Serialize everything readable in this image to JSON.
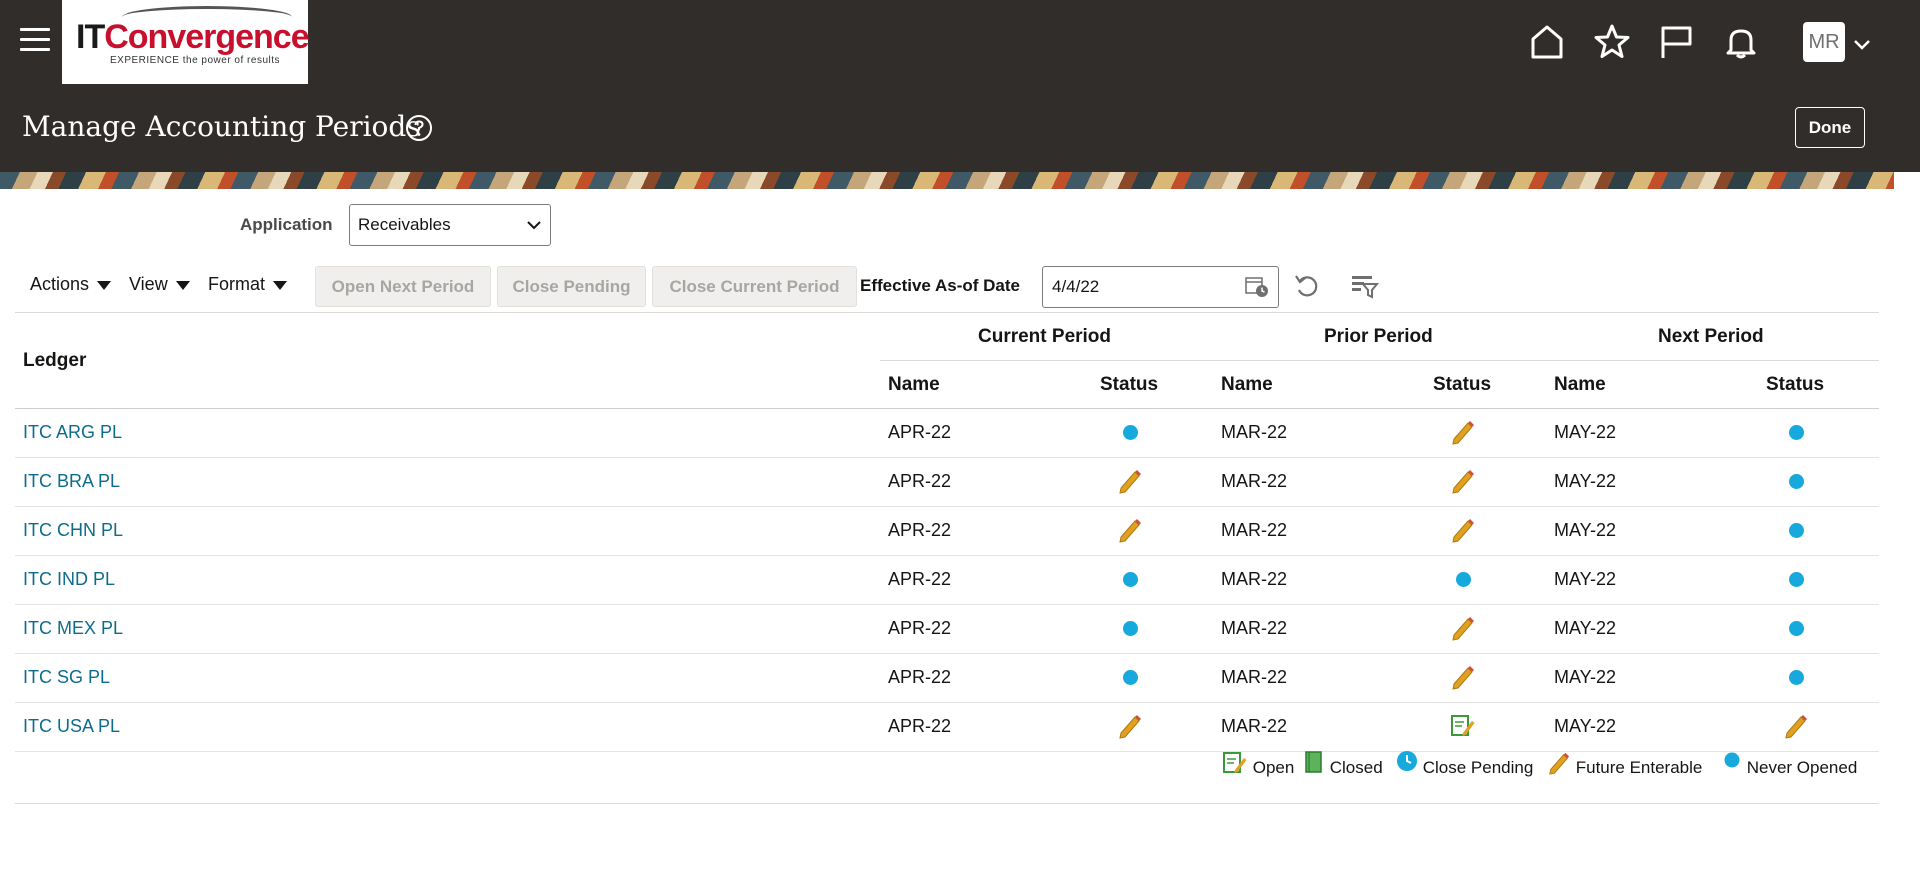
{
  "header": {
    "logo_it": "IT",
    "logo_conv": "Convergence",
    "logo_tag": "EXPERIENCE the power of results",
    "user_initials": "MR",
    "page_title": "Manage Accounting Periods",
    "done_label": "Done"
  },
  "filters": {
    "application_label": "Application",
    "application_value": "Receivables"
  },
  "toolbar": {
    "actions_label": "Actions",
    "view_label": "View",
    "format_label": "Format",
    "open_next_label": "Open Next Period",
    "close_pending_label": "Close Pending",
    "close_current_label": "Close Current Period",
    "effective_label": "Effective As-of Date",
    "effective_value": "4/4/22"
  },
  "table": {
    "ledger_header": "Ledger",
    "groups": [
      "Current Period",
      "Prior Period",
      "Next Period"
    ],
    "name_header": "Name",
    "status_header": "Status",
    "rows": [
      {
        "ledger": "ITC ARG PL",
        "cur_name": "APR-22",
        "cur_status": "never-opened",
        "prior_name": "MAR-22",
        "prior_status": "future-enterable",
        "next_name": "MAY-22",
        "next_status": "never-opened"
      },
      {
        "ledger": "ITC BRA PL",
        "cur_name": "APR-22",
        "cur_status": "future-enterable",
        "prior_name": "MAR-22",
        "prior_status": "future-enterable",
        "next_name": "MAY-22",
        "next_status": "never-opened"
      },
      {
        "ledger": "ITC CHN PL",
        "cur_name": "APR-22",
        "cur_status": "future-enterable",
        "prior_name": "MAR-22",
        "prior_status": "future-enterable",
        "next_name": "MAY-22",
        "next_status": "never-opened"
      },
      {
        "ledger": "ITC IND PL",
        "cur_name": "APR-22",
        "cur_status": "never-opened",
        "prior_name": "MAR-22",
        "prior_status": "never-opened",
        "next_name": "MAY-22",
        "next_status": "never-opened"
      },
      {
        "ledger": "ITC MEX PL",
        "cur_name": "APR-22",
        "cur_status": "never-opened",
        "prior_name": "MAR-22",
        "prior_status": "future-enterable",
        "next_name": "MAY-22",
        "next_status": "never-opened"
      },
      {
        "ledger": "ITC SG PL",
        "cur_name": "APR-22",
        "cur_status": "never-opened",
        "prior_name": "MAR-22",
        "prior_status": "future-enterable",
        "next_name": "MAY-22",
        "next_status": "never-opened"
      },
      {
        "ledger": "ITC USA PL",
        "cur_name": "APR-22",
        "cur_status": "future-enterable",
        "prior_name": "MAR-22",
        "prior_status": "open",
        "next_name": "MAY-22",
        "next_status": "future-enterable"
      }
    ]
  },
  "legend": {
    "open": "Open",
    "closed": "Closed",
    "close_pending": "Close Pending",
    "future_enterable": "Future Enterable",
    "never_opened": "Never Opened"
  },
  "colors": {
    "header_bg": "#312d2a",
    "link": "#0d6c8c",
    "never_opened_dot": "#17a9dc",
    "pencil": "#e0a020"
  }
}
